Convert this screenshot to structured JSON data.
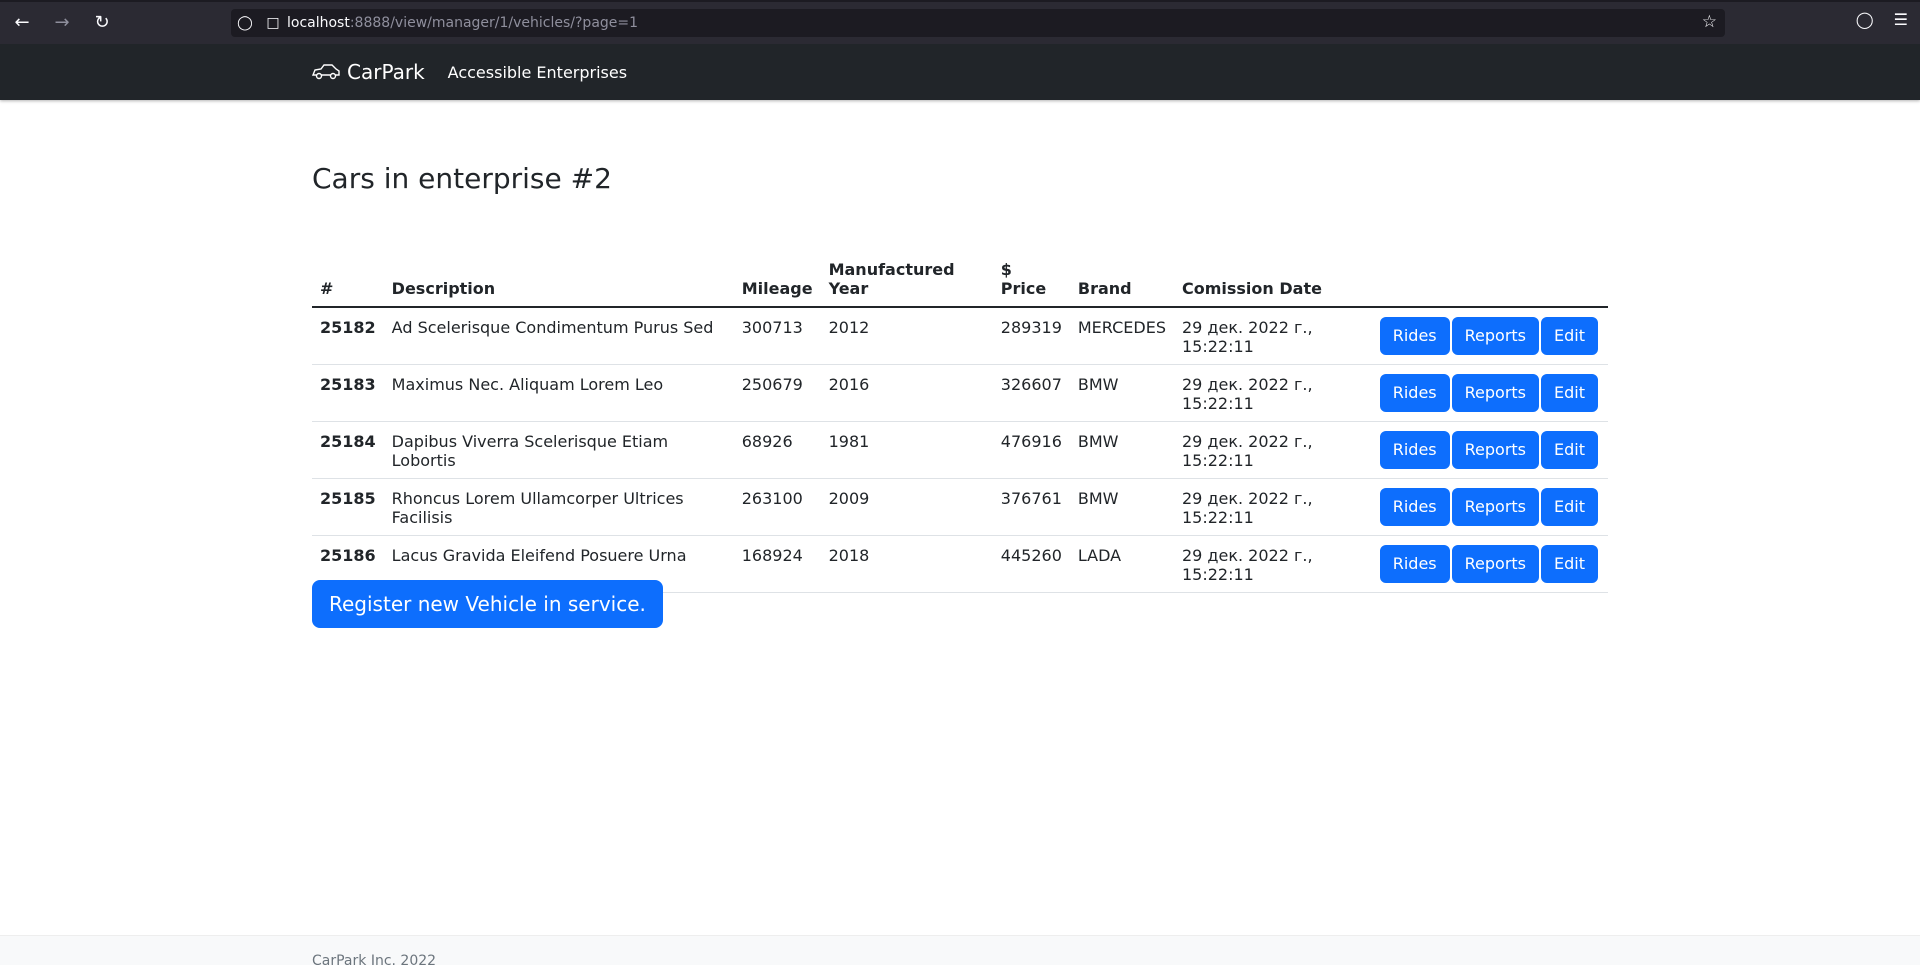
{
  "browser": {
    "url_host": "localhost",
    "url_rest": ":8888/view/manager/1/vehicles/?page=1"
  },
  "navbar": {
    "brand": "CarPark",
    "link": "Accessible Enterprises"
  },
  "page": {
    "title": "Cars in enterprise #2"
  },
  "table": {
    "headers": [
      "#",
      "Description",
      "Mileage",
      "Manufactured Year",
      "$ Price",
      "Brand",
      "Comission Date",
      ""
    ],
    "rows": [
      {
        "id": "25182",
        "description": "Ad Scelerisque Condimentum Purus Sed",
        "mileage": "300713",
        "year": "2012",
        "price": "289319",
        "brand": "MERCEDES",
        "date": "29 дек. 2022 г., 15:22:11"
      },
      {
        "id": "25183",
        "description": "Maximus Nec. Aliquam Lorem Leo",
        "mileage": "250679",
        "year": "2016",
        "price": "326607",
        "brand": "BMW",
        "date": "29 дек. 2022 г., 15:22:11"
      },
      {
        "id": "25184",
        "description": "Dapibus Viverra Scelerisque Etiam Lobortis",
        "mileage": "68926",
        "year": "1981",
        "price": "476916",
        "brand": "BMW",
        "date": "29 дек. 2022 г., 15:22:11"
      },
      {
        "id": "25185",
        "description": "Rhoncus Lorem Ullamcorper Ultrices Facilisis",
        "mileage": "263100",
        "year": "2009",
        "price": "376761",
        "brand": "BMW",
        "date": "29 дек. 2022 г., 15:22:11"
      },
      {
        "id": "25186",
        "description": "Lacus Gravida Eleifend Posuere Urna",
        "mileage": "168924",
        "year": "2018",
        "price": "445260",
        "brand": "LADA",
        "date": "29 дек. 2022 г., 15:22:11"
      }
    ],
    "actions": {
      "rides": "Rides",
      "reports": "Reports",
      "edit": "Edit"
    }
  },
  "register_button": "Register new Vehicle in service.",
  "footer": {
    "text": "CarPark Inc. 2022"
  },
  "colors": {
    "primary": "#0d6efd",
    "navbar": "#212529",
    "chrome": "#2b2a33"
  }
}
